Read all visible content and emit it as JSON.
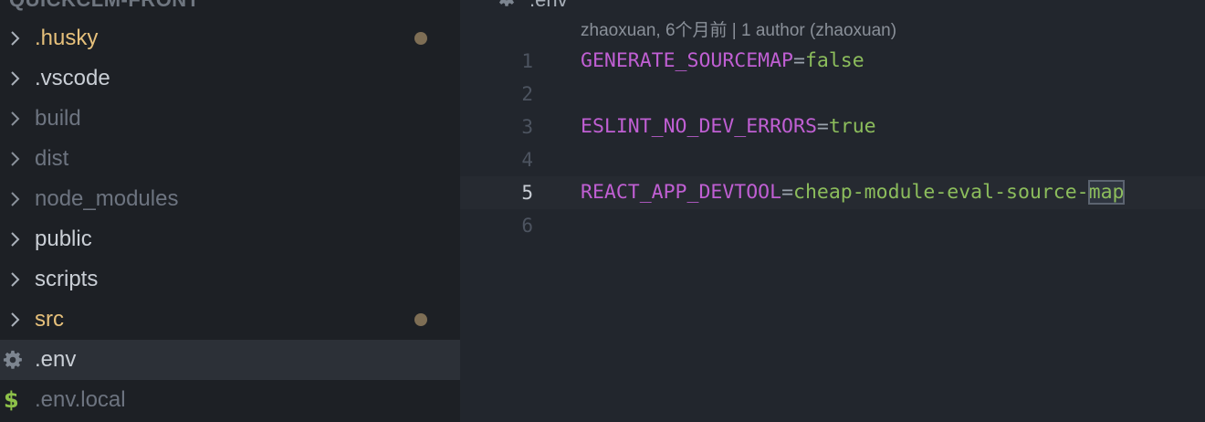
{
  "sidebar": {
    "header": "QUICKCLM-FRONT",
    "items": [
      {
        "label": ".husky",
        "kind": "folder",
        "color": "#e6c07b",
        "modified": true,
        "selected": false
      },
      {
        "label": ".vscode",
        "kind": "folder",
        "color": "#c9ced5",
        "modified": false,
        "selected": false
      },
      {
        "label": "build",
        "kind": "folder",
        "color": "#6d7480",
        "modified": false,
        "selected": false
      },
      {
        "label": "dist",
        "kind": "folder",
        "color": "#6d7480",
        "modified": false,
        "selected": false
      },
      {
        "label": "node_modules",
        "kind": "folder",
        "color": "#6d7480",
        "modified": false,
        "selected": false
      },
      {
        "label": "public",
        "kind": "folder",
        "color": "#c9ced5",
        "modified": false,
        "selected": false
      },
      {
        "label": "scripts",
        "kind": "folder",
        "color": "#c9ced5",
        "modified": false,
        "selected": false
      },
      {
        "label": "src",
        "kind": "folder",
        "color": "#e6c07b",
        "modified": true,
        "selected": false
      },
      {
        "label": ".env",
        "kind": "file",
        "icon": "gear-icon",
        "color": "#c9ced5",
        "modified": false,
        "selected": true
      },
      {
        "label": ".env.local",
        "kind": "file",
        "icon": "dollar-icon",
        "color": "#6d7480",
        "modified": false,
        "selected": false
      }
    ]
  },
  "editor": {
    "tab": {
      "icon": "gear-icon",
      "label": ".env"
    },
    "blame": "zhaoxuan, 6个月前 | 1 author (zhaoxuan)",
    "current_line": 5,
    "lines": [
      {
        "number": "1",
        "key": "GENERATE_SOURCEMAP",
        "eq": "=",
        "value": "false",
        "selection": ""
      },
      {
        "number": "2",
        "key": "",
        "eq": "",
        "value": "",
        "selection": ""
      },
      {
        "number": "3",
        "key": "ESLINT_NO_DEV_ERRORS",
        "eq": "=",
        "value": "true",
        "selection": ""
      },
      {
        "number": "4",
        "key": "",
        "eq": "",
        "value": "",
        "selection": ""
      },
      {
        "number": "5",
        "key": "REACT_APP_DEVTOOL",
        "eq": "=",
        "value": "cheap-module-eval-source-",
        "selection": "map"
      },
      {
        "number": "6",
        "key": "",
        "eq": "",
        "value": "",
        "selection": ""
      }
    ]
  },
  "colors": {
    "sidebar_bg": "#1d2025",
    "editor_bg": "#22262d",
    "key": "#c05fd3",
    "value": "#8cbd5c",
    "modified_dot": "#7e6e55",
    "dollar": "#8dc149"
  }
}
